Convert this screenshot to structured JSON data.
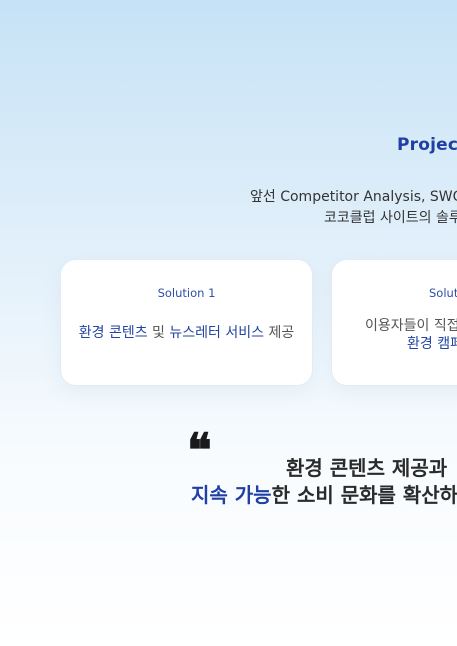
{
  "section": {
    "title": "Projec"
  },
  "description": {
    "line1": "앞선 Competitor Analysis, SWO",
    "line2": "코코클럽 사이트의 솔루"
  },
  "solutions": [
    {
      "label": "Solution 1",
      "text_highlight_1": "환경 콘텐츠",
      "text_plain_1": " 및 ",
      "text_highlight_2": "뉴스레터 서비스",
      "text_plain_2": " 제공"
    },
    {
      "label": "Solut",
      "line1": "이용자들이 직접",
      "line2": "환경 캠페"
    }
  ],
  "quote": {
    "mark": "❝",
    "line1": "환경 콘텐츠 제공과",
    "line2_highlight": "지속 가능",
    "line2_rest": "한 소비 문화를 확산하"
  },
  "colors": {
    "accent": "#1f3fa5",
    "highlight_text": "#2346a3",
    "body_text": "#333333",
    "background_top": "#c6e2f6",
    "background_bottom": "#ffffff"
  }
}
